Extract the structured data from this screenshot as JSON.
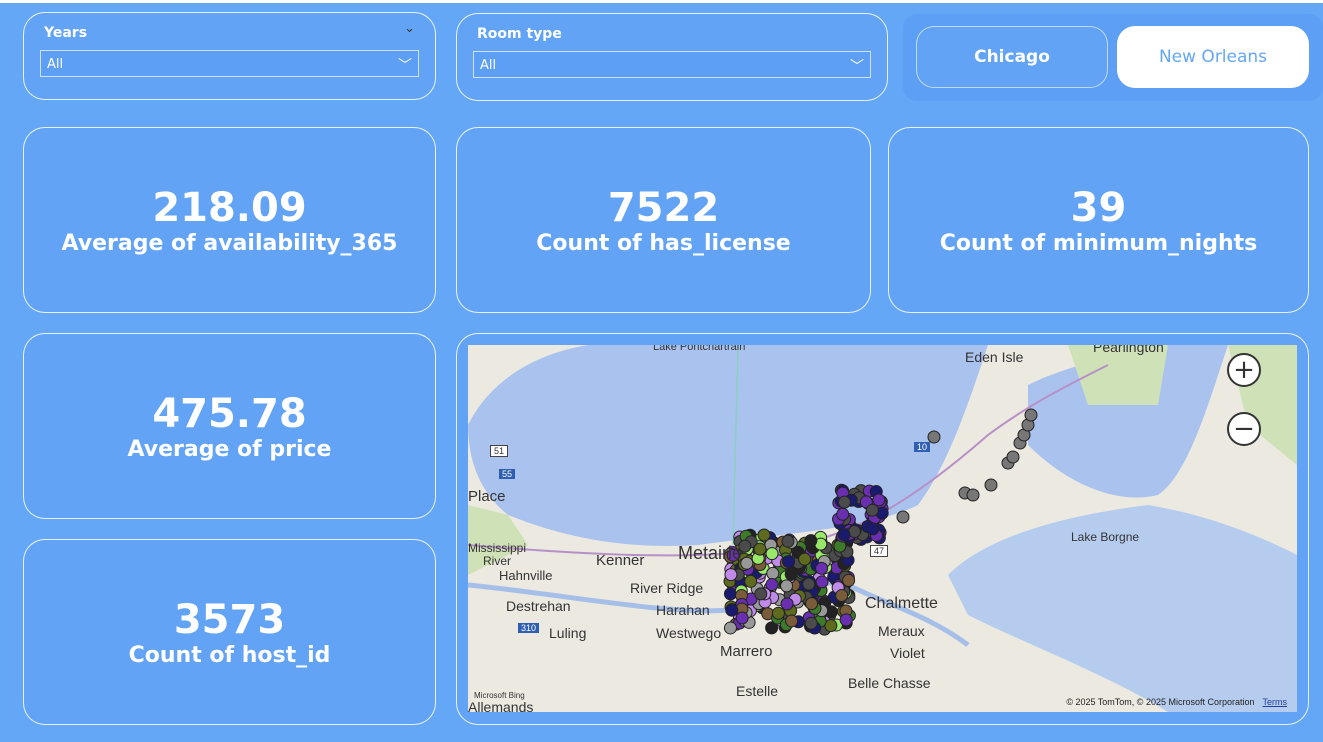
{
  "filters": {
    "years": {
      "label": "Years",
      "value": "All"
    },
    "room_type": {
      "label": "Room type",
      "value": "All"
    }
  },
  "city_buttons": [
    {
      "label": "Chicago",
      "selected": false
    },
    {
      "label": "New Orleans",
      "selected": true
    }
  ],
  "kpis": [
    {
      "value": "218.09",
      "label": "Average of availability_365"
    },
    {
      "value": "7522",
      "label": "Count of has_license"
    },
    {
      "value": "39",
      "label": "Count of minimum_nights"
    },
    {
      "value": "475.78",
      "label": "Average of price"
    },
    {
      "value": "3573",
      "label": "Count of host_id"
    }
  ],
  "map": {
    "labels": {
      "lake_pontchartrain": "Lake Pontchartrain",
      "eden_isle": "Eden Isle",
      "pearlington": "Pearlington",
      "place": "Place",
      "mississippi_river": "Mississippi",
      "river": "River",
      "kenner": "Kenner",
      "metairie": "Metairie",
      "river_ridge": "River Ridge",
      "harahan": "Harahan",
      "hahnville": "Hahnville",
      "destrehan": "Destrehan",
      "luling": "Luling",
      "westwego": "Westwego",
      "marrero": "Marrero",
      "chalmette": "Chalmette",
      "meraux": "Meraux",
      "violet": "Violet",
      "belle_chasse": "Belle Chasse",
      "estelle": "Estelle",
      "allemands": "Allemands",
      "lake_borgne": "Lake Borgne"
    },
    "shields": {
      "i51": "51",
      "i55": "55",
      "i10": "10",
      "r47": "47",
      "i310": "310"
    },
    "logo": "Microsoft Bing",
    "attribution": "© 2025 TomTom, © 2025 Microsoft Corporation",
    "terms": "Terms",
    "zoom_in": "+",
    "zoom_out": "−",
    "point_colors": [
      "#1a1a6e",
      "#4b4b4b",
      "#6a2fb0",
      "#9ae86a",
      "#5e6b1e",
      "#c08ae8",
      "#999999",
      "#3d7a2a",
      "#222222",
      "#7a5c3a"
    ]
  }
}
